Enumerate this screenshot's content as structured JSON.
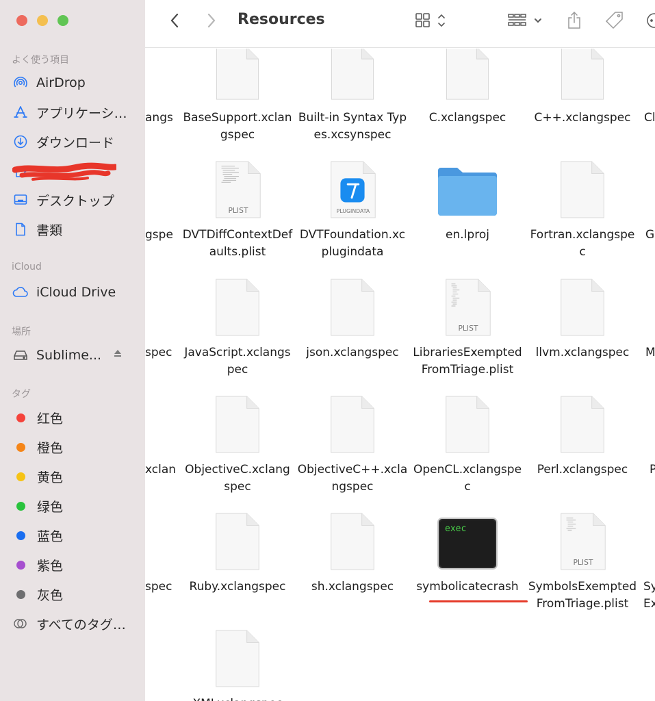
{
  "window": {
    "title": "Resources"
  },
  "sidebar": {
    "favorites_header": "よく使う項目",
    "favorites": [
      {
        "label": "AirDrop",
        "icon": "airdrop-icon"
      },
      {
        "label": "アプリケーシ…",
        "icon": "applications-icon"
      },
      {
        "label": "ダウンロード",
        "icon": "downloads-icon"
      },
      {
        "label": "",
        "icon": "home-icon"
      },
      {
        "label": "デスクトップ",
        "icon": "desktop-icon"
      },
      {
        "label": "書類",
        "icon": "documents-icon"
      }
    ],
    "icloud_header": "iCloud",
    "icloud_items": [
      {
        "label": "iCloud Drive",
        "icon": "cloud-icon"
      }
    ],
    "locations_header": "場所",
    "locations": [
      {
        "label": "Sublime...",
        "icon": "disk-icon"
      }
    ],
    "tags_header": "タグ",
    "tags": [
      {
        "label": "红色",
        "color": "#f5433b"
      },
      {
        "label": "橙色",
        "color": "#f58518"
      },
      {
        "label": "黄色",
        "color": "#f6c315"
      },
      {
        "label": "绿色",
        "color": "#29c33d"
      },
      {
        "label": "蓝色",
        "color": "#1a6ef0"
      },
      {
        "label": "紫色",
        "color": "#a64fcf"
      },
      {
        "label": "灰色",
        "color": "#6e6e70"
      }
    ],
    "all_tags": "すべてのタグ…"
  },
  "files": {
    "row1": [
      "BaseSupport.xclangspec",
      "Built-in Syntax Types.xcsynspec",
      "C.xclangspec",
      "C++.xclangspec"
    ],
    "row2": [
      "DVTDiffContextDefaults.plist",
      "DVTFoundation.xcplugindata",
      "en.lproj",
      "Fortran.xclangspec"
    ],
    "row3": [
      "JavaScript.xclangspec",
      "json.xclangspec",
      "LibrariesExemptedFromTriage.plist",
      "llvm.xclangspec"
    ],
    "row4": [
      "ObjectiveC.xclangspec",
      "ObjectiveC++.xclangspec",
      "OpenCL.xclangspec",
      "Perl.xclangspec"
    ],
    "row5": [
      "Ruby.xclangspec",
      "sh.xclangspec",
      "symbolicatecrash",
      "SymbolsExemptedFromTriage.plist"
    ],
    "row6": [
      "XMLxclangspec"
    ],
    "partials_left": [
      "angs",
      "gspe",
      "spec",
      "xclan",
      "spec"
    ],
    "partials_right": [
      "Cl",
      "G",
      "M",
      "P",
      "Sy"
    ],
    "partials_right_line2": [
      "Ex"
    ]
  },
  "file_badges": {
    "plist": "PLIST",
    "plugindata": "PLUGINDATA",
    "exec": "exec"
  },
  "colors": {
    "sidebar_bg": "#e9e3e4",
    "folder": "#5aa9e6",
    "underline": "#e53b2a",
    "redaction": "#e8362a"
  }
}
